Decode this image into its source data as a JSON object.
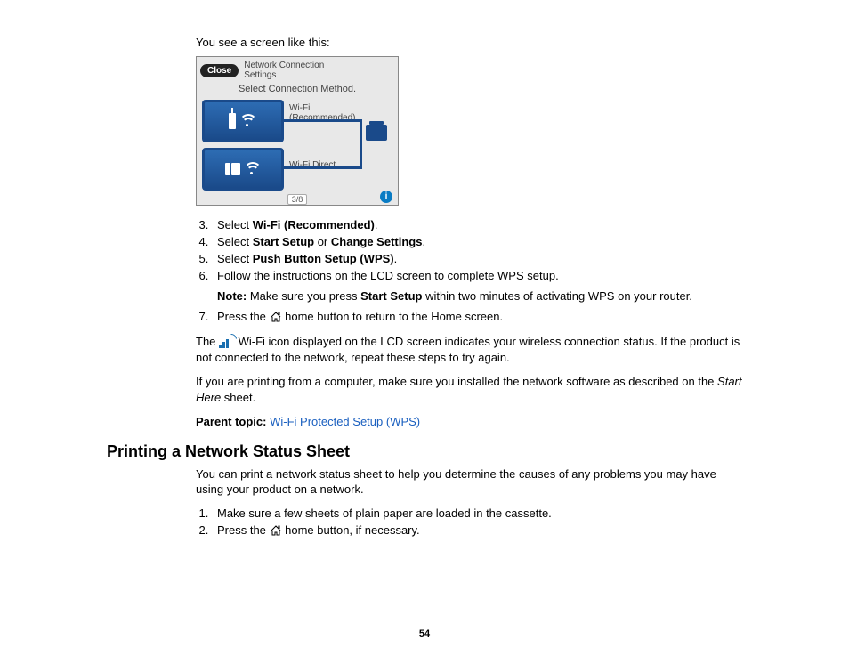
{
  "intro": "You see a screen like this:",
  "screenshot": {
    "close": "Close",
    "title_l1": "Network Connection",
    "title_l2": "Settings",
    "subtitle": "Select Connection Method.",
    "option1_l1": "Wi-Fi",
    "option1_l2": "(Recommended)",
    "option2": "Wi-Fi Direct",
    "page_indicator": "3/8",
    "info": "i"
  },
  "steps_a": {
    "s3_a": "Select ",
    "s3_b": "Wi-Fi (Recommended)",
    "s3_c": ".",
    "s4_a": "Select ",
    "s4_b": "Start Setup",
    "s4_c": " or ",
    "s4_d": "Change Settings",
    "s4_e": ".",
    "s5_a": "Select ",
    "s5_b": "Push Button Setup (WPS)",
    "s5_c": ".",
    "s6": "Follow the instructions on the LCD screen to complete WPS setup.",
    "note_a": "Note:",
    "note_b": " Make sure you press ",
    "note_c": "Start Setup",
    "note_d": " within two minutes of activating WPS on your router.",
    "s7_a": "Press the ",
    "s7_b": " home button to return to the Home screen."
  },
  "body": {
    "p1_a": "The ",
    "p1_b": " Wi-Fi icon displayed on the LCD screen indicates your wireless connection status. If the product is not connected to the network, repeat these steps to try again.",
    "p2_a": "If you are printing from a computer, make sure you installed the network software as described on the ",
    "p2_b": "Start Here",
    "p2_c": " sheet.",
    "parent_label": "Parent topic:",
    "parent_link": "Wi-Fi Protected Setup (WPS)"
  },
  "section2": {
    "heading": "Printing a Network Status Sheet",
    "intro": "You can print a network status sheet to help you determine the causes of any problems you may have using your product on a network.",
    "s1": "Make sure a few sheets of plain paper are loaded in the cassette.",
    "s2_a": "Press the ",
    "s2_b": " home button, if necessary."
  },
  "page_number": "54"
}
